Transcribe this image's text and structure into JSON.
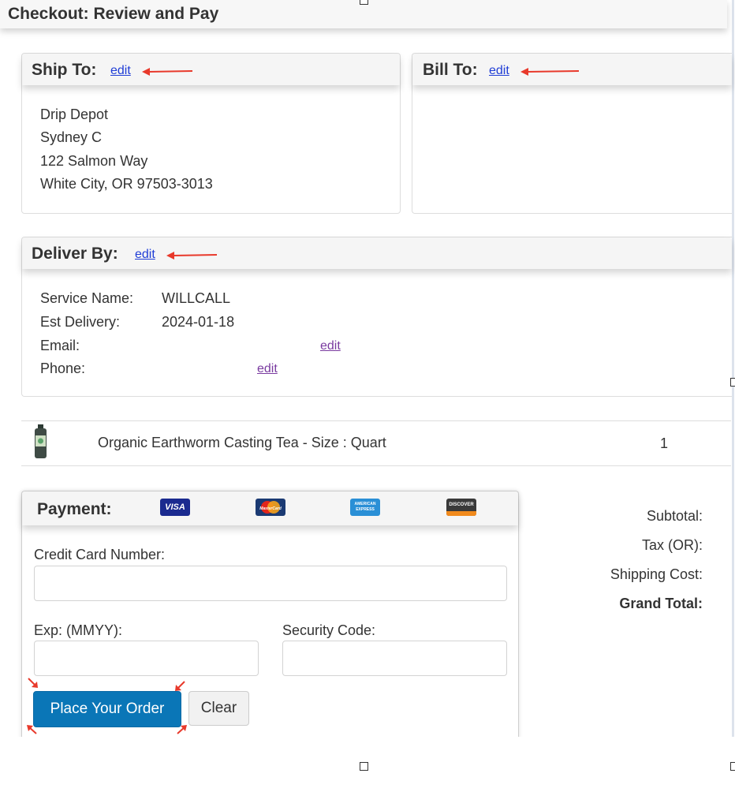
{
  "page": {
    "title": "Checkout: Review and Pay"
  },
  "ship_to": {
    "title": "Ship To:",
    "edit_label": "edit",
    "lines": [
      "Drip Depot",
      "Sydney C",
      "122 Salmon Way",
      "White City, OR 97503-3013"
    ]
  },
  "bill_to": {
    "title": "Bill To:",
    "edit_label": "edit"
  },
  "deliver_by": {
    "title": "Deliver By:",
    "edit_label": "edit",
    "service_label": "Service Name:",
    "service_value": "WILLCALL",
    "est_label": "Est Delivery:",
    "est_value": "2024-01-18",
    "email_label": "Email:",
    "email_edit": "edit",
    "phone_label": "Phone:",
    "phone_edit": "edit"
  },
  "cart": {
    "items": [
      {
        "name": "Organic Earthworm Casting Tea - Size : Quart",
        "quantity": "1"
      }
    ]
  },
  "payment": {
    "title": "Payment:",
    "cards": [
      "VISA",
      "MasterCard",
      "AMERICAN EXPRESS",
      "DISCOVER"
    ],
    "card_number_label": "Credit Card Number:",
    "exp_label": "Exp: (MMYY):",
    "security_label": "Security Code:",
    "place_order_label": "Place Your Order",
    "clear_label": "Clear"
  },
  "totals": {
    "subtotal_label": "Subtotal:",
    "tax_label": "Tax (OR):",
    "shipping_label": "Shipping Cost:",
    "grand_total_label": "Grand Total:"
  },
  "colors": {
    "link": "#1f3dd6",
    "visited_link": "#7a3ba0",
    "primary_button": "#0a76b7",
    "annotation_arrow": "#e8392b"
  }
}
